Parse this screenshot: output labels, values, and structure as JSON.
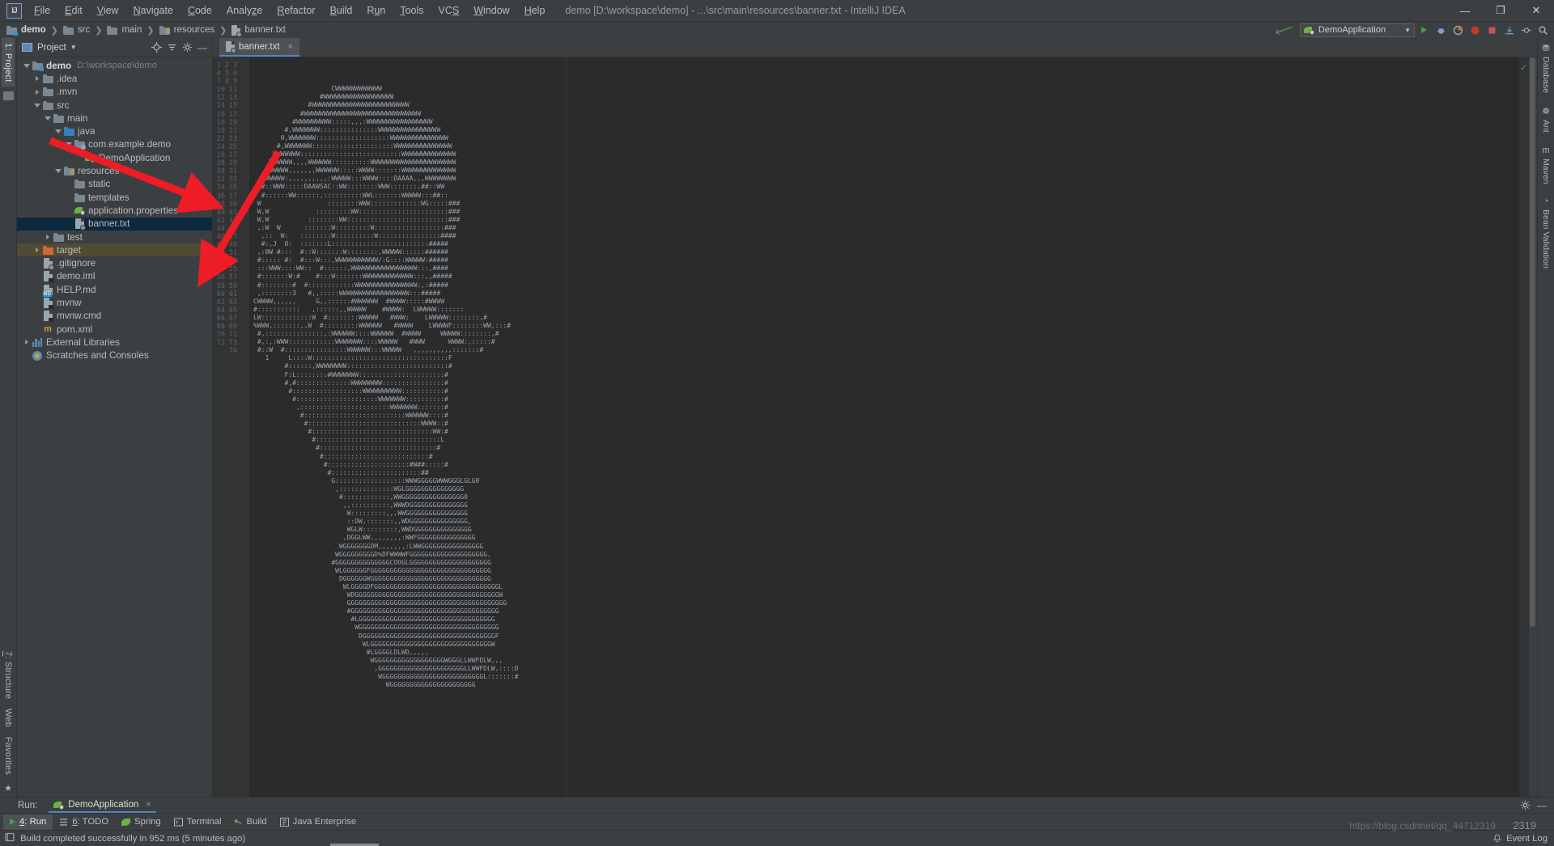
{
  "window": {
    "title": "demo [D:\\workspace\\demo] - ...\\src\\main\\resources\\banner.txt - IntelliJ IDEA",
    "logo": "IJ",
    "minimize": "—",
    "maximize": "❐",
    "close": "✕"
  },
  "menu": [
    {
      "label": "File",
      "mnemonic": "F"
    },
    {
      "label": "Edit",
      "mnemonic": "E"
    },
    {
      "label": "View",
      "mnemonic": "V"
    },
    {
      "label": "Navigate",
      "mnemonic": "N"
    },
    {
      "label": "Code",
      "mnemonic": "C"
    },
    {
      "label": "Analyze",
      "mnemonic": "z"
    },
    {
      "label": "Refactor",
      "mnemonic": "R"
    },
    {
      "label": "Build",
      "mnemonic": "B"
    },
    {
      "label": "Run",
      "mnemonic": "u"
    },
    {
      "label": "Tools",
      "mnemonic": "T"
    },
    {
      "label": "VCS",
      "mnemonic": "S"
    },
    {
      "label": "Window",
      "mnemonic": "W"
    },
    {
      "label": "Help",
      "mnemonic": "H"
    }
  ],
  "breadcrumb": [
    {
      "label": "demo",
      "icon": "module-folder-icon",
      "bold": true
    },
    {
      "label": "src",
      "icon": "folder-icon",
      "bold": false
    },
    {
      "label": "main",
      "icon": "folder-icon",
      "bold": false
    },
    {
      "label": "resources",
      "icon": "resources-folder-icon",
      "bold": false
    },
    {
      "label": "banner.txt",
      "icon": "text-file-icon",
      "bold": false
    }
  ],
  "toolbar": {
    "run_config": "DemoApplication",
    "icons": [
      "build-hammer-icon",
      "run-icon",
      "debug-icon",
      "run-with-coverage-icon",
      "profiler-icon",
      "attach-icon",
      "stop-icon",
      "update-project-icon",
      "commit-icon",
      "search-everywhere-icon"
    ]
  },
  "left_rail": {
    "active_tab": "1: Project",
    "active_tab_mnemonic": "1",
    "bottom_tabs": [
      "7: Structure",
      "Web",
      "Favorites"
    ],
    "bottom_mnemonics": [
      "7",
      "",
      ""
    ]
  },
  "project_panel": {
    "title": "Project",
    "head_icons": [
      "locate-icon",
      "collapse-all-icon",
      "settings-gear-icon",
      "hide-icon"
    ],
    "tree": [
      {
        "depth": 0,
        "label": "demo",
        "sub": "D:\\workspace\\demo",
        "icon": "module-folder-icon",
        "twisty": "open",
        "bold": true
      },
      {
        "depth": 1,
        "label": ".idea",
        "icon": "folder-icon",
        "twisty": "closed"
      },
      {
        "depth": 1,
        "label": ".mvn",
        "icon": "folder-icon",
        "twisty": "closed"
      },
      {
        "depth": 1,
        "label": "src",
        "icon": "folder-icon",
        "twisty": "open"
      },
      {
        "depth": 2,
        "label": "main",
        "icon": "folder-icon",
        "twisty": "open"
      },
      {
        "depth": 3,
        "label": "java",
        "icon": "source-folder-icon",
        "twisty": "open"
      },
      {
        "depth": 4,
        "label": "com.example.demo",
        "icon": "package-folder-icon",
        "twisty": "open"
      },
      {
        "depth": 5,
        "label": "DemoApplication",
        "icon": "spring-boot-class-icon",
        "twisty": "none"
      },
      {
        "depth": 3,
        "label": "resources",
        "icon": "resources-folder-icon",
        "twisty": "open"
      },
      {
        "depth": 4,
        "label": "static",
        "icon": "folder-icon",
        "twisty": "none"
      },
      {
        "depth": 4,
        "label": "templates",
        "icon": "folder-icon",
        "twisty": "none"
      },
      {
        "depth": 4,
        "label": "application.properties",
        "icon": "spring-properties-icon",
        "twisty": "none"
      },
      {
        "depth": 4,
        "label": "banner.txt",
        "icon": "text-file-icon",
        "twisty": "none",
        "selected": true
      },
      {
        "depth": 2,
        "label": "test",
        "icon": "folder-icon",
        "twisty": "closed"
      },
      {
        "depth": 1,
        "label": "target",
        "icon": "excluded-folder-icon",
        "twisty": "closed",
        "highlight": "target"
      },
      {
        "depth": 1,
        "label": ".gitignore",
        "icon": "ignore-file-icon",
        "twisty": "none"
      },
      {
        "depth": 1,
        "label": "demo.iml",
        "icon": "iml-file-icon",
        "twisty": "none"
      },
      {
        "depth": 1,
        "label": "HELP.md",
        "icon": "markdown-file-icon",
        "twisty": "none"
      },
      {
        "depth": 1,
        "label": "mvnw",
        "icon": "script-file-icon",
        "twisty": "none"
      },
      {
        "depth": 1,
        "label": "mvnw.cmd",
        "icon": "script-file-icon",
        "twisty": "none"
      },
      {
        "depth": 1,
        "label": "pom.xml",
        "icon": "maven-pom-icon",
        "twisty": "none"
      },
      {
        "depth": 0,
        "label": "External Libraries",
        "icon": "libraries-icon",
        "twisty": "closed"
      },
      {
        "depth": 0,
        "label": "Scratches and Consoles",
        "icon": "scratches-icon",
        "twisty": "none"
      }
    ]
  },
  "editor": {
    "tab": {
      "label": "banner.txt",
      "icon": "text-file-icon",
      "close": "×"
    },
    "first_line": 1,
    "last_line": 74,
    "inspection_status": "ok-checkmark-icon",
    "ascii_art_lines": [
      "                    CWWWWWWWWWWWW",
      "                 #WWWWWWWWWWWWWWWWWW",
      "              #WWWWWWWWWWWWWWWWWWWWWWWWW",
      "            #WWWWWWWWWWWWWWWWWWWWWWWWWWWWWW",
      "          #WWWWWWWWW:::::,,,:WWWWWWWWWWWWWWWWW",
      "        #,WWWWWWW:::::::::::::::WWWWWWWWWWWWWWWW",
      "       0,WWWWWWW:::::::::::::::::::WWWWWWWWWWWWWWW",
      "      #,WWWWWWW:::::::::::::::::::::WWWWWWWWWWWWWWW",
      "     WWWWWWW::::::::::::::::::::::::::WWWWWWWWWWWWWW",
      "    WWWWWW,,,,WWWWWW::::::::::WWWWWWWWWWWWWWWWWWWWWW",
      "   WWWWWW,,,,,,,WWWWWW:::::WWWW:::::::WWWWWWWWWWWWWW",
      "  ,WWWWW:,,,,,,,,,,:WWWWW:::WWWW::::DAAAA,,,WWWWWWWW",
      "  #::WWW:::::DAAWSAC::WW::::::::WWW:::::::,##::WW",
      "  #::::::WW::::::,::::::::::WWL:::::::WWWWW:::##::",
      " W                 ::::::::WWW:::::::::::::WG:::::###",
      " W,W            :::::::::WW:::::::::::::::::::::::###",
      " W,W          ::::::::WW::::::::::::::::::::::::::###",
      " ,:W  W      :::::::W:::::::::W::::::::::::::::::###",
      "  ,::  W:   ::::::::W::::::::::W::::::::::::::::####",
      "  #:,J  0:  :::::::L:::::::::::::::::::::::::#####",
      " ,:0W #:::  #::W:::::::W::::::::,WWWWW::::::######",
      " #::::: #:  #:::W:::,WWWWWWWWWWW/:G::::WWWWW:#####",
      " :::WWW::::WW::  #::::::,WWWWWWWWWWWWWWWWW:::,####",
      " #:::::::W:#    #:::W:::::::WWWWWWWWWWWWW:::,,#####",
      " #::::::::#  #::::::::::::WWWWWWWWWWWWWWWW:,:#####",
      " ,::::::::3   #,,:::::WWWWWWWWWWWWWWWWWW:::#####",
      "CWWWW,,,,,,     G,,::::::#WWWWWW  #WWWW:::::#WWWW",
      "#:::::::::::   ,::::::,,WWWWW    #WWWW:  LWWWWW:::::::",
      "LW:::::::::::::W  #::::::::WWWWW   #WWW:    LWWWWW::::::::,#",
      "%WWW,:::::::,,W  #:::::::::WWWWWW   #WWWW    LWWWWF::::::::WW,:::#",
      " #,:::::::::::::::,:WWWWWW::::WWWWWW  #WWWW     WWWWW::::::::,#",
      " #,:,:WWW::::::::::::WWWWWWW::::WWWWW   #WWW      WWWW:,:::::#",
      " #::W  #::::::::::::::::WWWWWW:::WWWWW   ,,,,,,,,,,:::::::#",
      "   1     L::::W:::::::::::::::::::::::::::::::::::F",
      "        #::::::,WWWWWWWW::::::::::::::::::::::::::#",
      "        F:L::::::::#WWWWWWW::::::::::::::::::::::#",
      "        #,#::::::::::::::WWWWWWWW::::::::::::::::#",
      "         #::::::::::::::::::WWWWWWWWWW:::::::::::#",
      "          #:::::::::::::::::::::WWWWWWW::::::::::#",
      "           ,:::::::::::::::::::::::WWWWWWW:::::::#",
      "            #::::::::::::::::::::::::::WWWWWW::::#",
      "             #:::::::::::::::::::::::::::::WWWW::#",
      "              #:::::::::::::::::::::::::::::::WW:#",
      "               #::::::::::::::::::::::::::::::::L",
      "                #::::::::::::::::::::::::::::::#",
      "                 #:::::::::::::::::::::::::::#",
      "                  #:::::::::::::::::::::#W##:::::#",
      "                   #:::::::::::::::::::::::##",
      "                    G::::::::::::::::::WWWGGGGGWWWGGGLGLG0",
      "                     ,::::::::::::::WGLGGGGGGGGGGGGGGG",
      "                      #::::::::::::,WWGGGGGGGGGGGGGGGG0",
      "                       ,,::::::::::,WWWDGGGGGGGGGGGGGGG",
      "                        W:::::::::,,,WWGGGGGGGGGGGGGGGG",
      "                        ::DW,:::::::,,WDGGGGGGGGGGGGGGG,",
      "                        WGLW:::::::::,WWDGGGGGGGGGGGGGGG",
      "                       ,DGGLWW,,,,,,,,:WWFGGGGGGGGGGGGGGG",
      "                      WGGGGGGGDM,,,,,,,:LWWGGGGGGGGGGGGGGGG",
      "                     WGGGGGGGGGD%DFWWWWFGGGGGGGGGGGGGGGGGGGG,",
      "                    #GGGGGGGGGGGGGGCOOGLGGGGGGGGGGGGGGGGGGGGG",
      "                     WLGGGGGGFGGGGGGGGGGGGGGGGGGGGGGGGGGGGGGG",
      "                      DGGGGGGWGGGGGGGGGGGGGGGGGGGGGGGGGGGGGGG",
      "                       WLGGGGDFGGGGGGGGGGGGGGGGGGGGGGGGGGGGGGGGL",
      "                        WDGGGGGGGGGGGGGGGGGGGGGGGGGGGGGGGGGGGGGW",
      "                        GGGGGGGGGGGGGGGGGGGGGGGGGGGGGGGGGGGGGGGGG",
      "                        #GGGGGGGGGGGGGGGGGGGGGGGGGGGGGGGGGGGGGG",
      "                         #LGGGGGGGGGGGGGGGGGGGGGGGGGGGGGGGGGGG",
      "                          WGGGGGGGGGGGGGGGGGGGGGGGGGGGGGGGGGGGG",
      "                           DGGGGGGGGGGGGGGGGGGGGGGGGGGGGGGGGGGF",
      "                            WLGGGGGGGGGGGGGGGGGGGGGGGGGGGGGGGW",
      "                             #LGGGGLDLWD,,,,,",
      "                              WGGGGGGGGGGGGGGGGGGWGGGLLWWFDLW,,,",
      "                               ,GGGGGGGGGGGGGGGGGGGGGGLLWWFDLW,::::D",
      "                                WGGGGGGGGGGGGGGGGGGGGGGGGGGL:::::::#",
      "                                  WGGGGGGGGGGGGGGGGGGGGGG"
    ]
  },
  "right_rail": [
    {
      "label": "Database",
      "icon": "database-icon"
    },
    {
      "label": "Ant",
      "icon": "ant-icon"
    },
    {
      "label": "Maven",
      "icon": "maven-icon"
    },
    {
      "label": "Bean Validation",
      "icon": "bean-validation-icon"
    }
  ],
  "run_window": {
    "label": "Run:",
    "tab": "DemoApplication",
    "tab_icon": "spring-boot-icon",
    "tab_close": "×",
    "settings_icon": "gear-icon",
    "hide_icon": "minimize-icon"
  },
  "bottom_strip": [
    {
      "label": "4: Run",
      "mnemonic": "4",
      "icon": "play-icon",
      "active": true
    },
    {
      "label": "6: TODO",
      "mnemonic": "6",
      "icon": "todo-list-icon",
      "active": false
    },
    {
      "label": "Spring",
      "mnemonic": "",
      "icon": "spring-leaf-icon",
      "active": false
    },
    {
      "label": "Terminal",
      "mnemonic": "",
      "icon": "terminal-icon",
      "active": false
    },
    {
      "label": "Build",
      "mnemonic": "",
      "icon": "hammer-icon",
      "active": false
    },
    {
      "label": "Java Enterprise",
      "mnemonic": "",
      "icon": "java-enterprise-icon",
      "active": false
    }
  ],
  "statusbar": {
    "icon": "build-status-icon",
    "message": "Build completed successfully in 952 ms (5 minutes ago)",
    "event_log": "Event Log",
    "event_log_icon": "bell-icon"
  },
  "watermark": {
    "text": "https://blog.csdnnet/qq_44712319",
    "number": "2319"
  },
  "colors": {
    "bg": "#3c3f41",
    "editor_bg": "#2b2b2b",
    "gutter_bg": "#313335",
    "selection": "#0d293e",
    "target_highlight": "#514b35",
    "accent_blue": "#4a88c7",
    "green": "#499c54",
    "spring_green": "#6db33f",
    "orange": "#cf6a35",
    "annotation_red": "#ee1c25",
    "text": "#bbbbbb"
  }
}
